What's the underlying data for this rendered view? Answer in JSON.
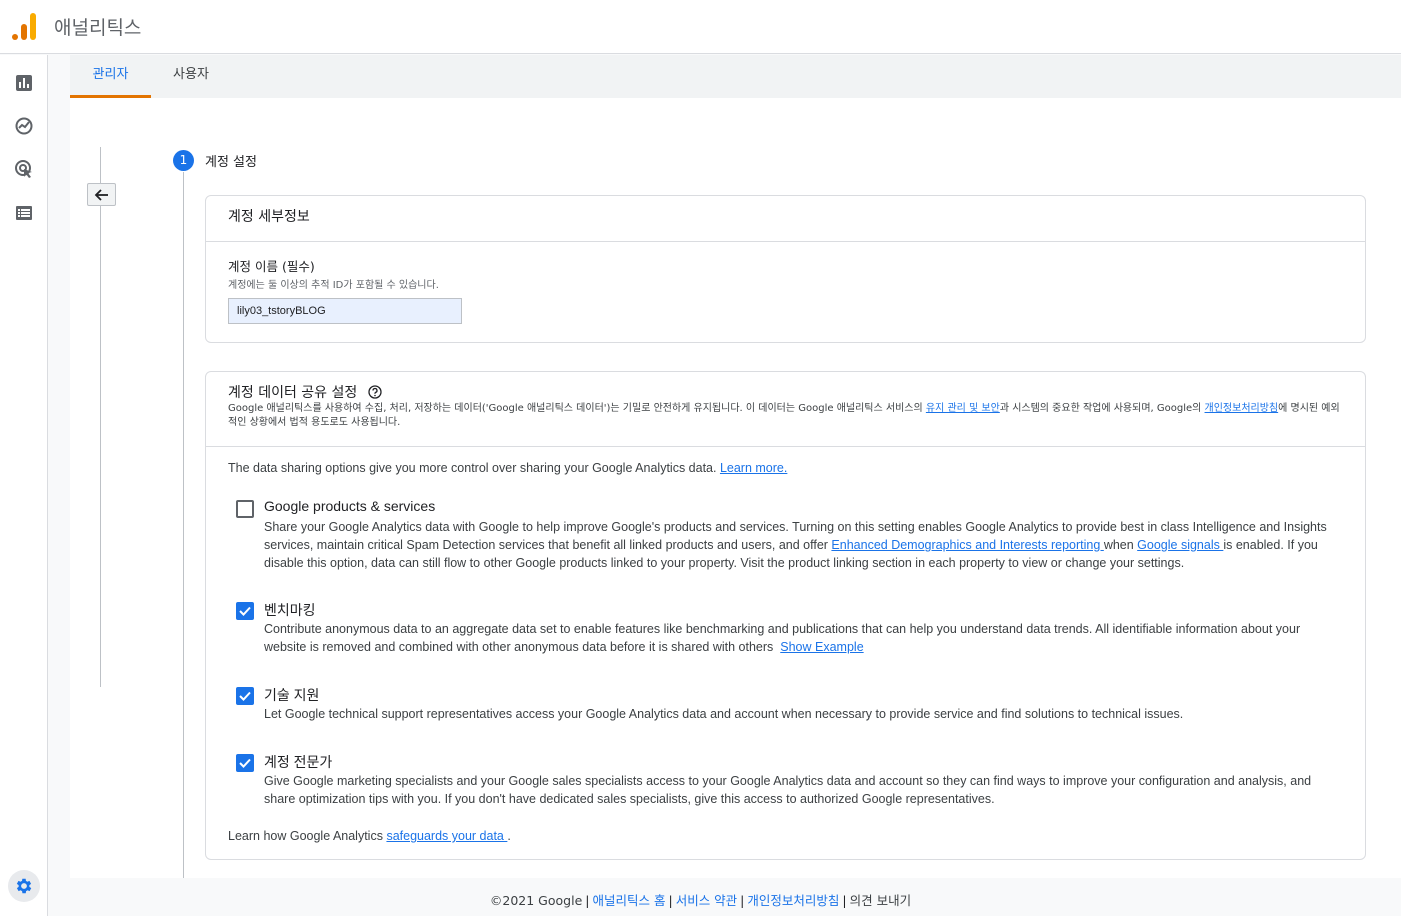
{
  "app": {
    "title": "애널리틱스",
    "logo_colors": [
      "#e37400",
      "#f9ab00"
    ],
    "accent": "#1a73e8"
  },
  "leftnav": {
    "items": [
      {
        "icon": "bar-chart-icon"
      },
      {
        "icon": "explore-icon"
      },
      {
        "icon": "advertising-icon"
      },
      {
        "icon": "table-list-icon"
      }
    ],
    "settings_icon": "gear-icon"
  },
  "tabs": [
    {
      "label": "관리자",
      "active": true
    },
    {
      "label": "사용자",
      "active": false
    }
  ],
  "step": {
    "number": "1",
    "title": "계정 설정"
  },
  "account_details": {
    "title": "계정 세부정보",
    "name_label": "계정 이름 (필수)",
    "name_hint": "계정에는 둘 이상의 추적 ID가 포함될 수 있습니다.",
    "name_value": "lily03_tstoryBLOG"
  },
  "sharing": {
    "title": "계정 데이터 공유 설정",
    "desc_part1": "Google 애널리틱스를 사용하여 수집, 처리, 저장하는 데이터('Google 애널리틱스 데이터')는 기밀로 안전하게 유지됩니다. 이 데이터는 Google 애널리틱스 서비스의 ",
    "desc_link1": "유지 관리 및 보안",
    "desc_part2": "과 시스템의 중요한 작업에 사용되며, Google의 ",
    "desc_link2": "개인정보처리방침",
    "desc_part3": "에 명시된 예외적인 상황에서 법적 용도로도 사용됩니다.",
    "intro_text": "The data sharing options give you more control over sharing your Google Analytics data. ",
    "intro_link": "Learn more.",
    "options": [
      {
        "title": "Google products & services",
        "checked": false,
        "desc_part1": "Share your Google Analytics data with Google to help improve Google's products and services. Turning on this setting enables Google Analytics to provide best in class Intelligence and Insights services, maintain critical Spam Detection services that benefit all linked products and users, and offer ",
        "desc_link1": "Enhanced Demographics and Interests reporting ",
        "desc_part2": "when ",
        "desc_link2": "Google signals ",
        "desc_part3": "is enabled. If you disable this option, data can still flow to other Google products linked to your property. Visit the product linking section in each property to view or change your settings."
      },
      {
        "title": "벤치마킹",
        "checked": true,
        "desc": "Contribute anonymous data to an aggregate data set to enable features like benchmarking and publications that can help you understand data trends. All identifiable information about your website is removed and combined with other anonymous data before it is shared with others",
        "link": "Show Example"
      },
      {
        "title": "기술 지원",
        "checked": true,
        "desc": "Let Google technical support representatives access your Google Analytics data and account when necessary to provide service and find solutions to technical issues."
      },
      {
        "title": "계정 전문가",
        "checked": true,
        "desc": "Give Google marketing specialists and your Google sales specialists access to your Google Analytics data and account so they can find ways to improve your configuration and analysis, and share optimization tips with you. If you don't have dedicated sales specialists, give this access to authorized Google representatives."
      }
    ],
    "learn_text": "Learn how Google Analytics ",
    "learn_link": "safeguards your data ",
    "learn_end": "."
  },
  "footer": {
    "copyright": "©2021 Google",
    "links": [
      "애널리틱스 홈",
      "서비스 약관",
      "개인정보처리방침"
    ],
    "feedback": "의견 보내기"
  }
}
